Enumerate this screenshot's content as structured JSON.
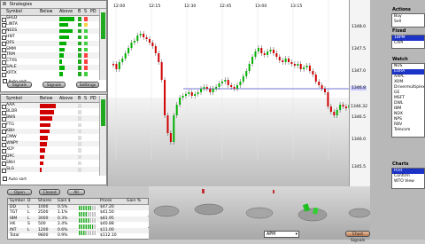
{
  "left_top": {
    "title_label": "Strategies",
    "columns": [
      "Symbol",
      "Below",
      "Above",
      "B",
      "S",
      "PD"
    ],
    "rows": [
      {
        "symbol": "SHLD",
        "above": 0.85,
        "s": "#ff4040"
      },
      {
        "symbol": "LINTA",
        "above": 0.5,
        "s": "#ffd040"
      },
      {
        "symbol": "NEES",
        "above": 0.75,
        "s": "#40d040"
      },
      {
        "symbol": "HNT",
        "above": 0.55,
        "s": "#40d040"
      },
      {
        "symbol": "DFS",
        "above": 0.4,
        "s": "#40d040"
      },
      {
        "symbol": "SMM",
        "above": 0.3,
        "s": "#40d040"
      },
      {
        "symbol": "TRM",
        "above": 0.25,
        "s": "#ff4040"
      },
      {
        "symbol": "CTXS",
        "above": 0.15,
        "s": "#ff4040"
      },
      {
        "symbol": "SALE",
        "above": 0.3,
        "s": "#ff4040"
      },
      {
        "symbol": "KRTX",
        "above": 0.2,
        "s": "#40d040"
      }
    ],
    "auto_sort": "Auto sort",
    "buttons": [
      "Signals",
      "Signals",
      "Settings"
    ]
  },
  "left_mid": {
    "columns": [
      "Symbol",
      "Below",
      "Above",
      "B",
      "S",
      "PD"
    ],
    "rows": [
      {
        "symbol": "AAA",
        "below": 0.9
      },
      {
        "symbol": "BLDR",
        "below": 0.8
      },
      {
        "symbol": "BWS",
        "below": 0.7
      },
      {
        "symbol": "FTG",
        "below": 0.6
      },
      {
        "symbol": "KBH",
        "below": 0.55
      },
      {
        "symbol": "CMW",
        "below": 0.45
      },
      {
        "symbol": "WNPY",
        "below": 0.4
      },
      {
        "symbol": "XCP",
        "below": 0.3
      },
      {
        "symbol": "DPC",
        "below": 0.25
      },
      {
        "symbol": "SNH",
        "below": 0.2
      },
      {
        "symbol": "SLG",
        "below": 0.12
      }
    ],
    "auto_sort": "Auto sort",
    "buttons": [
      "Open",
      "Closed",
      "All"
    ]
  },
  "positions": {
    "columns": [
      "Symbol",
      "D",
      "Shares",
      "Gain $",
      "Prices",
      "Gain %"
    ],
    "rows": [
      {
        "symbol": "DD",
        "d": "L",
        "shares": "1000",
        "gain": "0.5%",
        "price": "$47.20"
      },
      {
        "symbol": "TGT",
        "d": "L",
        "shares": "2500",
        "gain": "1.1%",
        "price": "$41.50"
      },
      {
        "symbol": "IBM",
        "d": "L",
        "shares": "3000",
        "gain": "0.3%",
        "price": "$81.95"
      },
      {
        "symbol": "HK",
        "d": "S",
        "shares": "500",
        "gain": "2.4%",
        "price": "$40.88"
      },
      {
        "symbol": "INT",
        "d": "L",
        "shares": "1200",
        "gain": "0.6%",
        "price": "$11.00"
      },
      {
        "symbol": "Total",
        "d": "",
        "shares": "9800",
        "gain": "0.9%",
        "price": "$112.10"
      }
    ],
    "gauges": [
      0.7,
      0.5,
      0.6,
      0.8,
      0.4
    ]
  },
  "chart": {
    "time_labels": [
      "12:00",
      "12:15",
      "12:30",
      "12:45",
      "13:00",
      "13:15"
    ],
    "price_labels": [
      "1348.0",
      "1347.5",
      "1347.0",
      "1346.5",
      "1346.0",
      "1345.5"
    ],
    "line_label": "1346.8",
    "current_label": "1346.32"
  },
  "bottom_bar": {
    "dropdown_value": "APM",
    "buttons": [
      "Chart Signals",
      "Notifications"
    ]
  },
  "right": {
    "actions_label": "Actions",
    "actions_items": [
      "Buy",
      "Sell"
    ],
    "fixed_label": "Fixed",
    "fixed_items": [
      "1BPM",
      "CAPI"
    ],
    "watch_label": "Watch",
    "watch_items": [
      "NUS",
      "EURA",
      "AAPL",
      "XOM",
      "Drivermultiplex",
      "GE",
      "MSFT",
      "DWL",
      "IBM",
      "NDX",
      "NPS",
      "RBV",
      "Telecom"
    ],
    "charts_label": "Charts",
    "charts_items": [
      "Hint",
      "Confirm",
      "WTO View"
    ],
    "selected_watch": "EURA",
    "selected_chart": "Hint"
  },
  "colors": {
    "green": "#00b000",
    "red": "#d00000",
    "blue": "#1c33c8"
  }
}
